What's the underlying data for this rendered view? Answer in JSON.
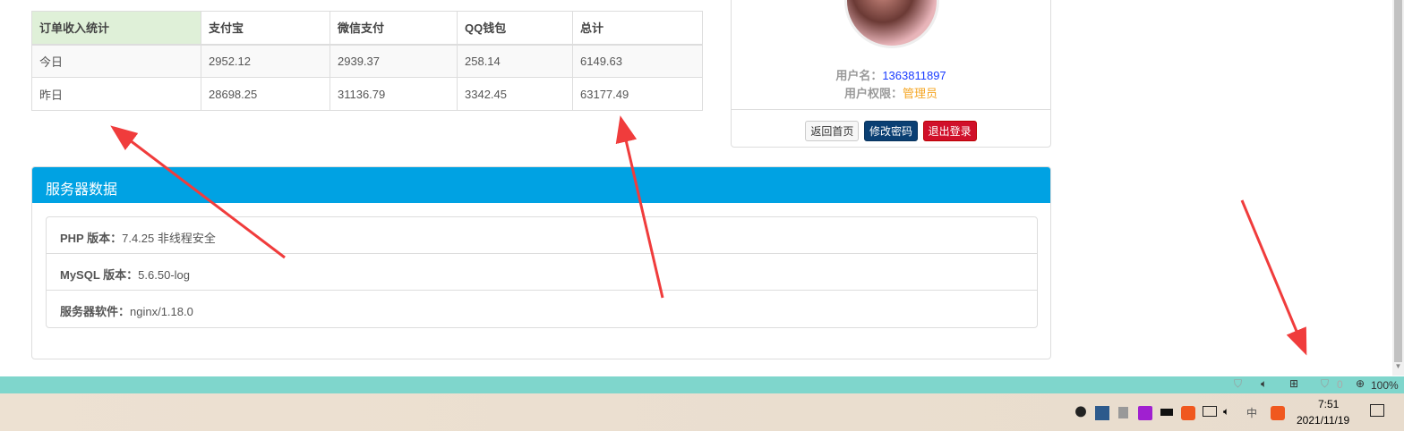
{
  "income_table": {
    "headers": [
      "订单收入统计",
      "支付宝",
      "微信支付",
      "QQ钱包",
      "总计"
    ],
    "rows": [
      [
        "今日",
        "2952.12",
        "2939.37",
        "258.14",
        "6149.63"
      ],
      [
        "昨日",
        "28698.25",
        "31136.79",
        "3342.45",
        "63177.49"
      ]
    ]
  },
  "profile": {
    "username_label": "用户名：",
    "username": "1363811897",
    "role_label": "用户权限：",
    "role": "管理员",
    "buttons": {
      "home": "返回首页",
      "change_password": "修改密码",
      "logout": "退出登录"
    }
  },
  "server": {
    "title": "服务器数据",
    "items": [
      {
        "label": "PHP 版本：",
        "value": "7.4.25 非线程安全"
      },
      {
        "label": "MySQL 版本：",
        "value": "5.6.50-log"
      },
      {
        "label": "服务器软件：",
        "value": "nginx/1.18.0"
      }
    ]
  },
  "statusbar": {
    "ad_count": "0",
    "zoom": "100%"
  },
  "taskbar": {
    "time": "7:51",
    "date": "2021/11/19",
    "ime": "中"
  }
}
